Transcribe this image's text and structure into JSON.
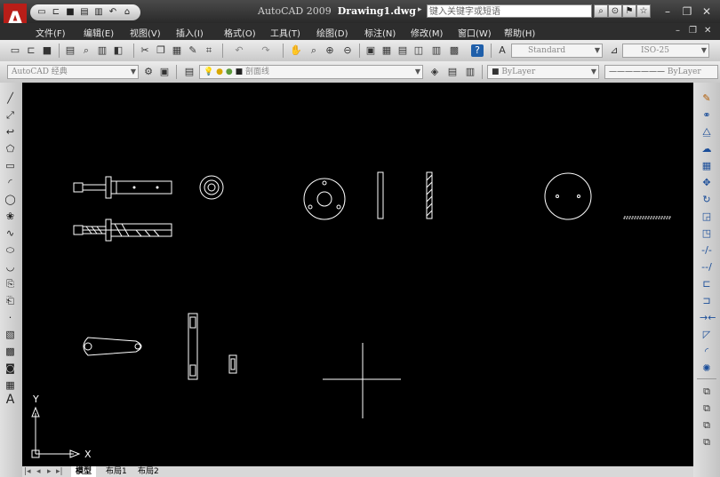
{
  "app": {
    "name": "AutoCAD 2009",
    "document": "Drawing1.dwg"
  },
  "search": {
    "placeholder": "键入关键字或短语"
  },
  "menus": [
    "文件(F)",
    "编辑(E)",
    "视图(V)",
    "插入(I)",
    "格式(O)",
    "工具(T)",
    "绘图(D)",
    "标注(N)",
    "修改(M)",
    "窗口(W)",
    "帮助(H)"
  ],
  "toolbar": {
    "text_style": "Standard",
    "dim_style": "ISO-25",
    "workspace": "AutoCAD 经典",
    "layer": "剖面线",
    "color": "ByLayer",
    "linetype": "ByLayer"
  },
  "ucs": {
    "x_label": "X",
    "y_label": "Y"
  },
  "layout_tabs": [
    "模型",
    "布局1",
    "布局2"
  ],
  "active_tab": "模型",
  "colors": {
    "canvas": "#000000",
    "accent": "#c8201a"
  }
}
